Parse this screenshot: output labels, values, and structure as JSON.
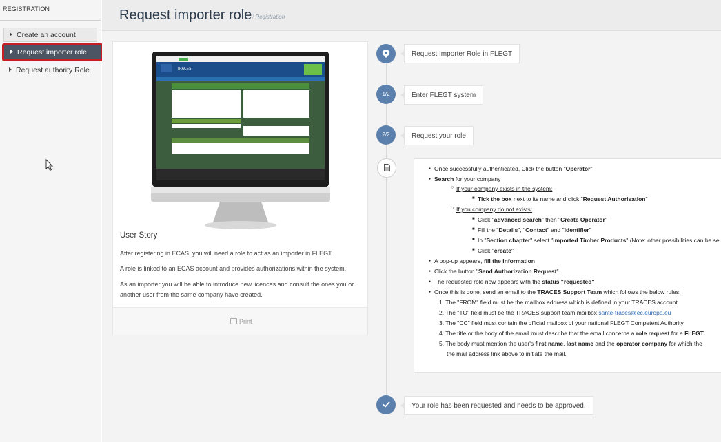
{
  "sidebar": {
    "header": "REGISTRATION",
    "items": [
      {
        "label": "Create an account"
      },
      {
        "label": "Request importer role"
      },
      {
        "label": "Request authority Role"
      }
    ]
  },
  "header": {
    "title": "Request importer role",
    "breadcrumb": "Registration"
  },
  "card": {
    "story_title": "User Story",
    "paragraphs": [
      "After registering in ECAS, you will need a role to act as an importer in FLEGT.",
      "A role is linked to an ECAS account and provides authorizations within the system.",
      "As an importer you will be able to introduce new licences and consult the ones you or",
      "another user from the same company have created."
    ],
    "print_label": "Print",
    "mock_brand": "TRACES"
  },
  "timeline": {
    "steps": [
      {
        "badge": "",
        "icon": "map-marker-icon",
        "label": "Request Importer Role in FLEGT"
      },
      {
        "badge": "1/2",
        "label": "Enter FLEGT system"
      },
      {
        "badge": "2/2",
        "label": "Request your role"
      },
      {
        "badge": "",
        "icon": "document-icon",
        "label": ""
      },
      {
        "badge": "",
        "icon": "checkmark-icon",
        "label": "Your role has been requested and needs to be approved."
      }
    ]
  },
  "instructions": {
    "l1a": "Once successfully authenticated, Click the button \"",
    "l1b": "Operator",
    "l1c": "\"",
    "l2a": "Search",
    "l2b": " for your company",
    "l3": "If your company exists in the system:",
    "l4a": "Tick the box",
    "l4b": " next to its name and click \"",
    "l4c": "Request Authorisation",
    "l4d": "\"",
    "l5": "If you company do not exists:",
    "l6a": "Click \"",
    "l6b": "advanced search",
    "l6c": "\" then \"",
    "l6d": "Create Operator",
    "l6e": "\"",
    "l7a": "Fill the \"",
    "l7b": "Details",
    "l7c": "\", \"",
    "l7d": "Contact",
    "l7e": "\" and \"",
    "l7f": "Identifier",
    "l7g": "\"",
    "l8a": "In \"",
    "l8b": "Section chapter",
    "l8c": "\" select \"",
    "l8d": "imported Timber Products",
    "l8e": "\" (Note: other possibilities can be sel",
    "l9a": "Click \"",
    "l9b": "create",
    "l9c": "\"",
    "l10a": "A pop-up appears, ",
    "l10b": "fill the information",
    "l11a": "Click the button \"",
    "l11b": "Send Authorization Request",
    "l11c": "\".",
    "l12a": "The requested role now appears with the ",
    "l12b": "status \"requested\"",
    "l13a": "Once this is done, send an email to the ",
    "l13b": "TRACES Support Team",
    "l13c": " which follows the below rules:",
    "n1": "1. The \"FROM\" field must be the mailbox address which is defined in your TRACES account",
    "n2a": "2. The \"TO\" field must be the TRACES support team mailbox  ",
    "n2b": "sante-traces@ec.europa.eu",
    "n3": "3. The \"CC\" field must contain the official mailbox of your national FLEGT Competent Authority",
    "n4a": "4. The title or the body of the email must describe that the email concerns a ",
    "n4b": "role request",
    "n4c": " for a ",
    "n4d": "FLEGT",
    "n5a": "5. The body must mention the user's ",
    "n5b": "first name",
    "n5c": ", ",
    "n5d": "last name",
    "n5e": " and the ",
    "n5f": "operator company",
    "n5g": " for which the",
    "n6": "the mail address link above to initiate the mail."
  },
  "colors": {
    "accent": "#5b80ad",
    "active_border": "#c91d26",
    "active_bg": "#4b5563"
  }
}
